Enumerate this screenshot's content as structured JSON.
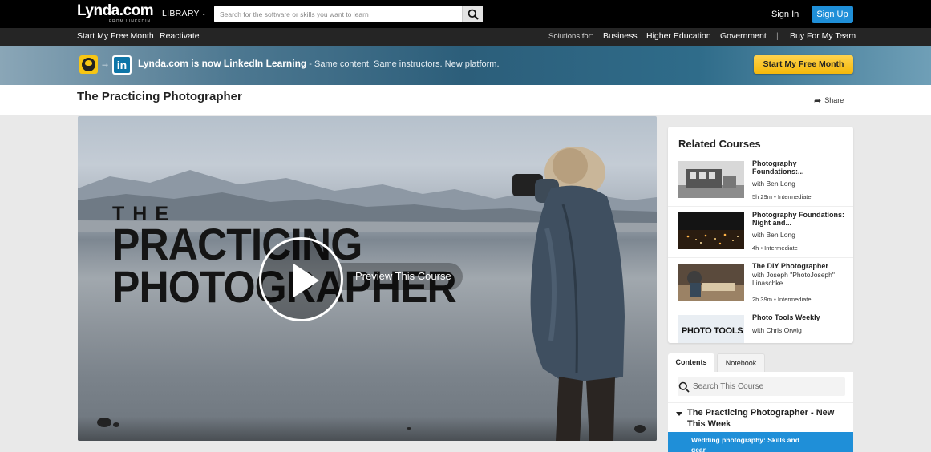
{
  "header": {
    "logo_main": "Lynda.com",
    "logo_sub": "FROM LINKEDIN",
    "library_label": "LIBRARY",
    "search_placeholder": "Search for the software or skills you want to learn",
    "signin_label": "Sign In",
    "signup_label": "Sign Up"
  },
  "subnav": {
    "free_month": "Start My Free Month",
    "reactivate": "Reactivate",
    "solutions_label": "Solutions for:",
    "business": "Business",
    "higher_ed": "Higher Education",
    "government": "Government",
    "divider": "|",
    "buy_team": "Buy For My Team"
  },
  "banner": {
    "headline": "Lynda.com is now LinkedIn Learning",
    "tagline": " - Same content. Same instructors. New platform.",
    "cta_label": "Start My Free Month",
    "linkedin_glyph": "in",
    "arrow_glyph": "→"
  },
  "course": {
    "title": "The Practicing Photographer",
    "share_label": "Share"
  },
  "video": {
    "overlay_the": "THE",
    "overlay_line1": "PRACTICING",
    "overlay_line2": "PHOTOGRAPHER",
    "preview_label": "Preview This Course"
  },
  "related": {
    "heading": "Related Courses",
    "items": [
      {
        "title": "Photography Foundations:...",
        "author": "with Ben Long",
        "duration": "5h 29m",
        "level": "Intermediate"
      },
      {
        "title": "Photography Foundations: Night and...",
        "author": "with Ben Long",
        "duration": "4h",
        "level": "Intermediate"
      },
      {
        "title": "The DIY Photographer",
        "author": "with Joseph \"PhotoJoseph\" Linaschke",
        "duration": "2h 39m",
        "level": "Intermediate"
      },
      {
        "title": "Photo Tools Weekly",
        "author": "with Chris Orwig",
        "thumb_text": "PHOTO TOOLS"
      }
    ],
    "meta_sep": "•"
  },
  "contents_panel": {
    "tab_contents": "Contents",
    "tab_notebook": "Notebook",
    "search_placeholder": "Search This Course",
    "chapter_title": "The Practicing Photographer - New This Week",
    "active_video": "Wedding photography: Skills and gear"
  },
  "colors": {
    "accent_blue": "#1f8fd8",
    "cta_yellow": "#f5b80a",
    "header_black": "#000000",
    "linkedin_blue": "#0e76a8"
  },
  "icons": [
    "search-icon",
    "chevron-down-icon",
    "lynda-logo-icon",
    "arrow-right-icon",
    "linkedin-icon",
    "share-icon",
    "play-icon",
    "caret-down-icon"
  ]
}
